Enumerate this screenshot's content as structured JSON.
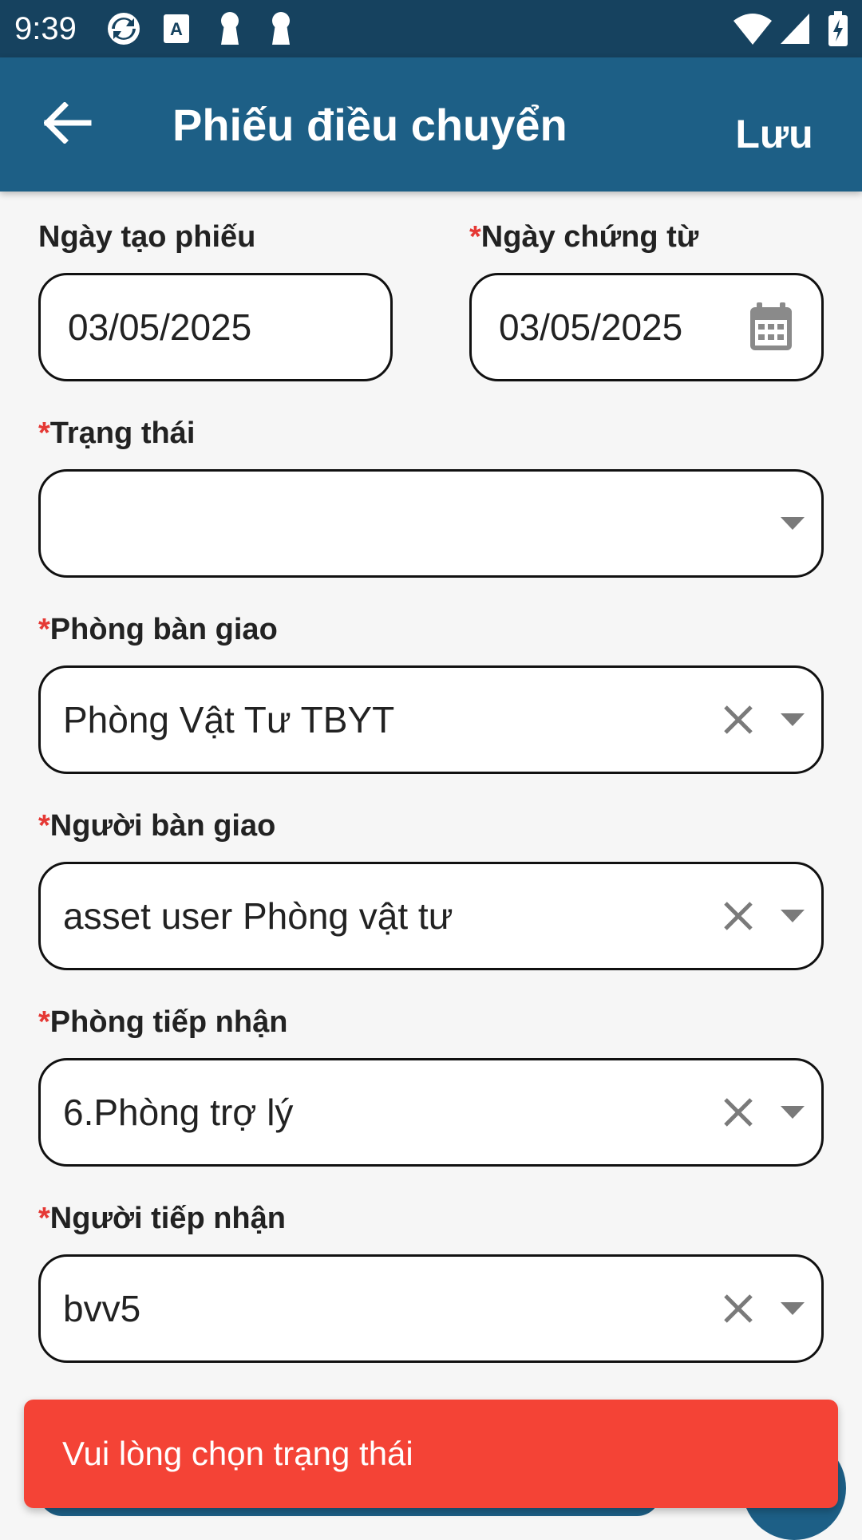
{
  "status_bar": {
    "time": "9:39",
    "left_icons": [
      "sync-icon",
      "translate-icon",
      "keyhole-icon",
      "keyhole-icon"
    ],
    "right_icons": [
      "wifi-icon",
      "signal-icon",
      "battery-charging-icon"
    ]
  },
  "app_bar": {
    "title": "Phiếu điều chuyển",
    "save_label": "Lưu",
    "back_icon": "arrow-left-icon",
    "color": "#1d5f86"
  },
  "form": {
    "required_mark": "*",
    "created_date": {
      "label": "Ngày tạo phiếu",
      "value": "03/05/2025"
    },
    "document_date": {
      "label": "Ngày chứng từ",
      "value": "03/05/2025",
      "icon": "calendar-icon"
    },
    "status": {
      "label": "Trạng thái",
      "value": ""
    },
    "handover_department": {
      "label": "Phòng bàn giao",
      "value": "Phòng Vật Tư TBYT"
    },
    "handover_person": {
      "label": "Người bàn giao",
      "value": "asset user Phòng vật tư"
    },
    "receiving_department": {
      "label": "Phòng tiếp nhận",
      "value": "6.Phòng trợ lý"
    },
    "receiving_person": {
      "label": "Người tiếp nhận",
      "value": "bvv5"
    }
  },
  "snackbar": {
    "message": "Vui lòng chọn trạng thái",
    "color": "#f44336"
  }
}
